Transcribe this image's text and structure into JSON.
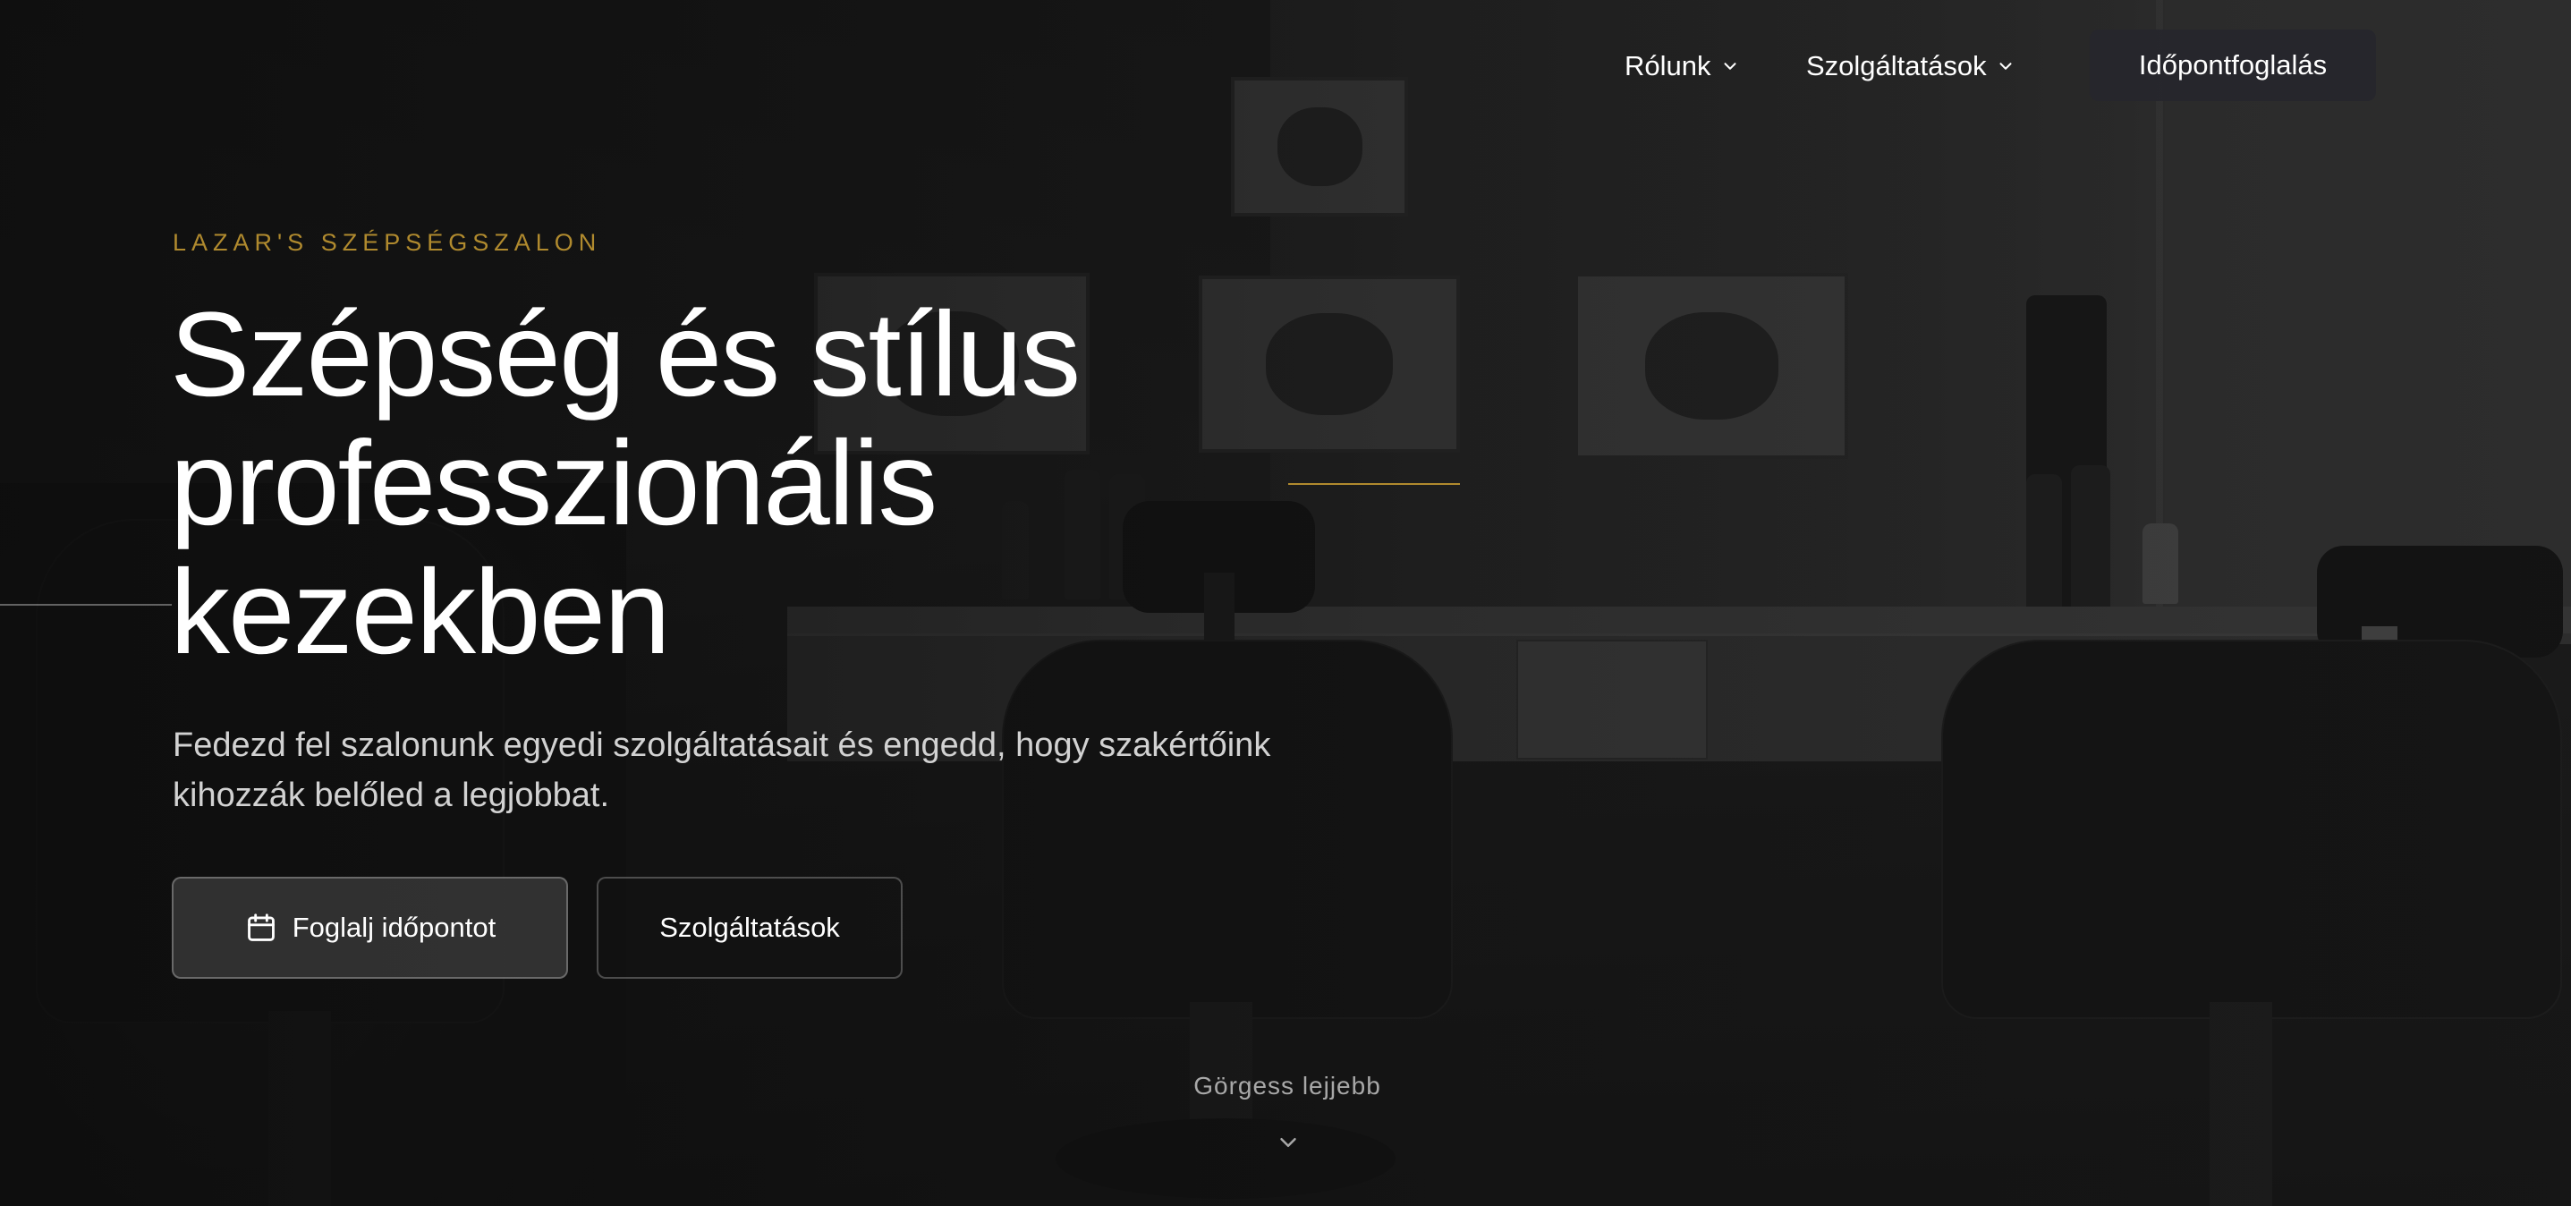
{
  "nav": {
    "about_label": "Rólunk",
    "services_label": "Szolgáltatások",
    "booking_label": "Időpontfoglalás"
  },
  "hero": {
    "eyebrow": "LAZAR'S SZÉPSÉGSZALON",
    "headline_lines": [
      "Szépség és stílus",
      "professzionális",
      "kezekben"
    ],
    "lead_lines": [
      "Fedezd fel szalonunk egyedi szolgáltatásait és engedd, hogy szakértőink",
      "kihozzák belőled a legjobbat."
    ],
    "primary_button": "Foglalj időpontot",
    "secondary_button": "Szolgáltatások",
    "scroll_hint": "Görgess lejjebb"
  },
  "colors": {
    "accent_gold": "#b08a2e",
    "cta_background": "#26262c"
  },
  "icons": {
    "nav_dropdown": "chevron-down-icon",
    "primary_button": "calendar-icon",
    "scroll": "chevron-down-icon"
  }
}
